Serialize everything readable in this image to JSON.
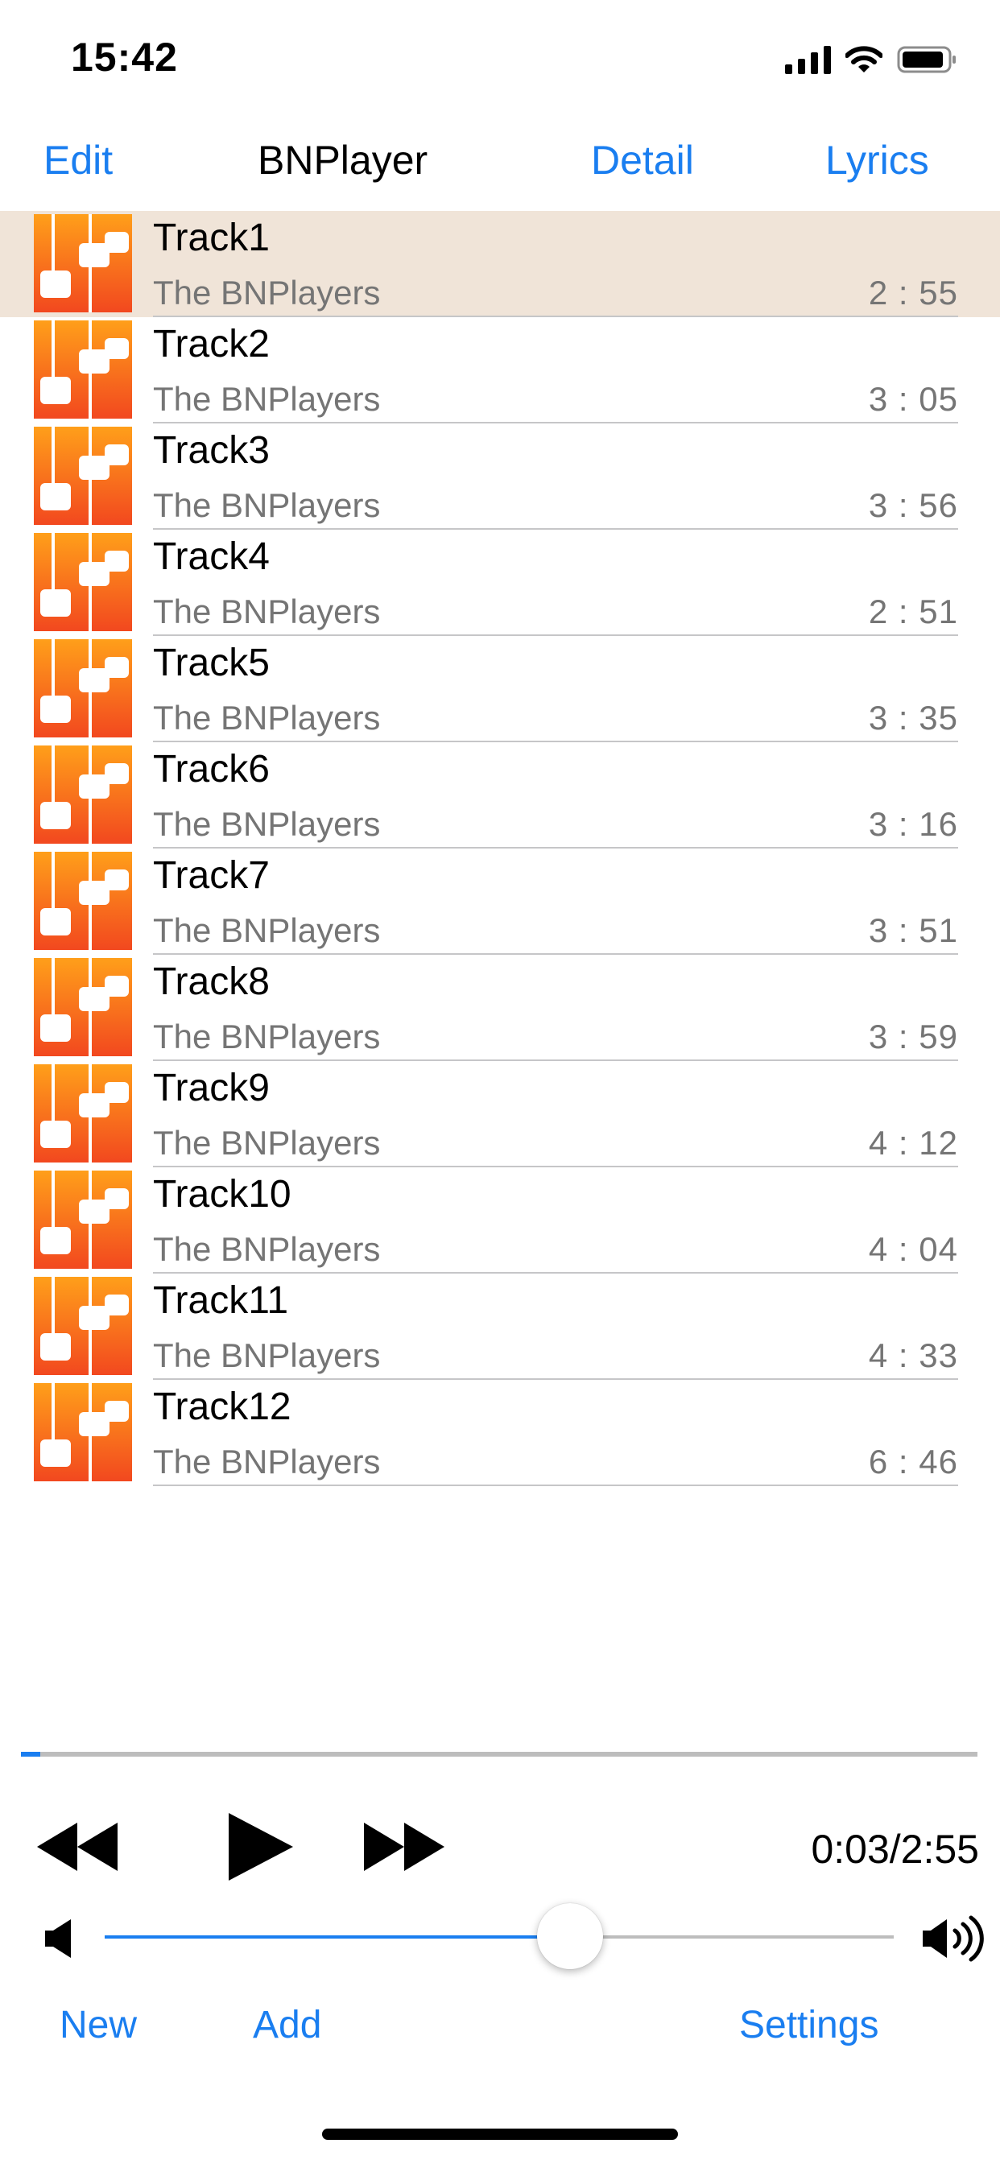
{
  "status_bar": {
    "time": "15:42",
    "icons": [
      "cellular-signal-icon",
      "wifi-icon",
      "battery-icon"
    ]
  },
  "nav": {
    "edit_label": "Edit",
    "title": "BNPlayer",
    "detail_label": "Detail",
    "lyrics_label": "Lyrics"
  },
  "tracks": [
    {
      "title": "Track1",
      "artist": "The BNPlayers",
      "duration": "2 : 55",
      "selected": true
    },
    {
      "title": "Track2",
      "artist": "The BNPlayers",
      "duration": "3 : 05",
      "selected": false
    },
    {
      "title": "Track3",
      "artist": "The BNPlayers",
      "duration": "3 : 56",
      "selected": false
    },
    {
      "title": "Track4",
      "artist": "The BNPlayers",
      "duration": "2 : 51",
      "selected": false
    },
    {
      "title": "Track5",
      "artist": "The BNPlayers",
      "duration": "3 : 35",
      "selected": false
    },
    {
      "title": "Track6",
      "artist": "The BNPlayers",
      "duration": "3 : 16",
      "selected": false
    },
    {
      "title": "Track7",
      "artist": "The BNPlayers",
      "duration": "3 : 51",
      "selected": false
    },
    {
      "title": "Track8",
      "artist": "The BNPlayers",
      "duration": "3 : 59",
      "selected": false
    },
    {
      "title": "Track9",
      "artist": "The BNPlayers",
      "duration": "4 : 12",
      "selected": false
    },
    {
      "title": "Track10",
      "artist": "The BNPlayers",
      "duration": "4 : 04",
      "selected": false
    },
    {
      "title": "Track11",
      "artist": "The BNPlayers",
      "duration": "4 : 33",
      "selected": false
    },
    {
      "title": "Track12",
      "artist": "The BNPlayers",
      "duration": "6 : 46",
      "selected": false
    }
  ],
  "player": {
    "time_readout": "0:03/2:55",
    "progress_fraction": 0.02,
    "volume_fraction": 0.59,
    "icons": [
      "rewind-icon",
      "play-icon",
      "fast-forward-icon",
      "volume-low-icon",
      "volume-high-icon"
    ]
  },
  "toolbar": {
    "new_label": "New",
    "add_label": "Add",
    "settings_label": "Settings"
  },
  "colors": {
    "accent": "#1a7ef0",
    "selected_row": "#f0e4d8",
    "secondary_text": "#757575",
    "artwork_top": "#ff9f1a",
    "artwork_bottom": "#f2481f"
  }
}
